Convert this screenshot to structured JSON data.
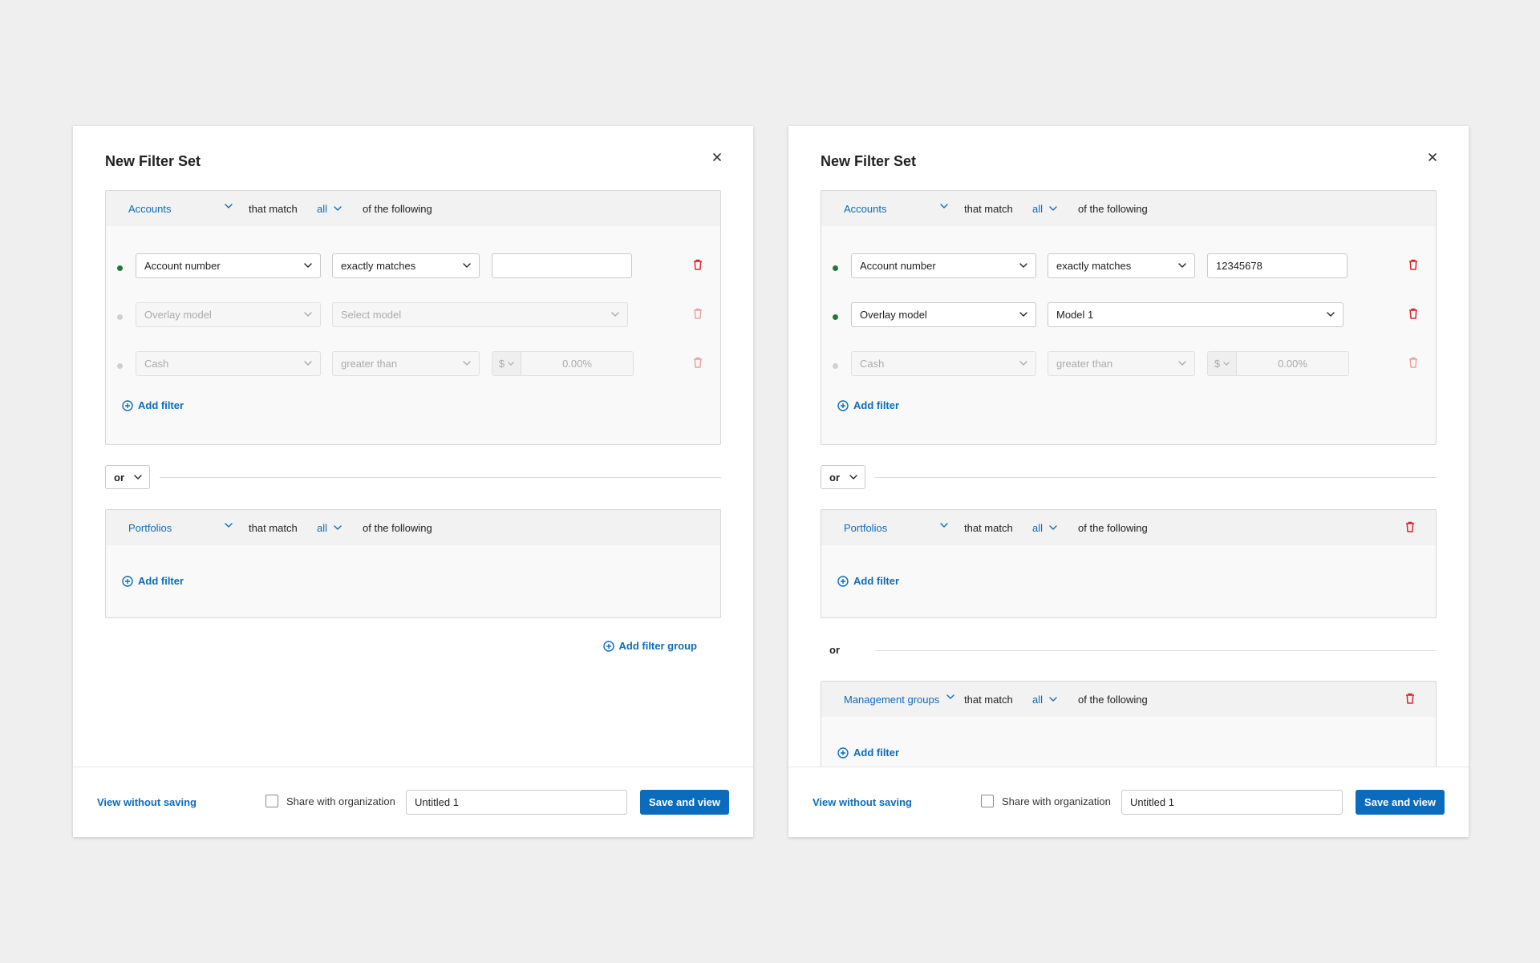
{
  "colors": {
    "accent": "#0b6cbd",
    "danger": "#d9262c",
    "active_dot": "#1f7a3a",
    "inactive_dot": "#d0d0d0"
  },
  "icons": {
    "close": "close-icon",
    "chevron": "chevron-down-icon",
    "delete": "trash-icon",
    "add": "plus-circle-icon"
  },
  "left": {
    "title": "New Filter Set",
    "groups": [
      {
        "entity": "Accounts",
        "that_match": "that match",
        "all": "all",
        "of_following": "of the following",
        "filters": [
          {
            "field": "Account number",
            "operator": "exactly matches",
            "value": ""
          },
          {
            "field": "Overlay  model",
            "operator_placeholder": "Select model"
          },
          {
            "field": "Cash",
            "operator": "greater than",
            "currency": "$",
            "value_placeholder": "0.00%"
          }
        ],
        "add_filter": "Add filter"
      },
      {
        "entity": "Portfolios",
        "that_match": "that match",
        "all": "all",
        "of_following": "of the following",
        "add_filter": "Add filter"
      }
    ],
    "or_label": "or",
    "add_filter_group": "Add filter group",
    "footer": {
      "view_without_saving": "View without saving",
      "share_label": "Share with organization",
      "name_value": "Untitled 1",
      "save_label": "Save and view"
    }
  },
  "right": {
    "title": "New Filter Set",
    "groups": [
      {
        "entity": "Accounts",
        "that_match": "that match",
        "all": "all",
        "of_following": "of the following",
        "filters": [
          {
            "field": "Account number",
            "operator": "exactly matches",
            "value": "12345678"
          },
          {
            "field": "Overlay  model",
            "operator": "Model 1"
          },
          {
            "field": "Cash",
            "operator": "greater than",
            "currency": "$",
            "value_placeholder": "0.00%"
          }
        ],
        "add_filter": "Add filter"
      },
      {
        "entity": "Portfolios",
        "that_match": "that match",
        "all": "all",
        "of_following": "of the following",
        "add_filter": "Add filter"
      },
      {
        "entity": "Management groups",
        "that_match": "that match",
        "all": "all",
        "of_following": "of the following",
        "add_filter": "Add filter"
      }
    ],
    "or_label": "or",
    "or_label_2": "or",
    "footer": {
      "view_without_saving": "View without saving",
      "share_label": "Share with organization",
      "name_value": "Untitled 1",
      "save_label": "Save and view"
    }
  }
}
